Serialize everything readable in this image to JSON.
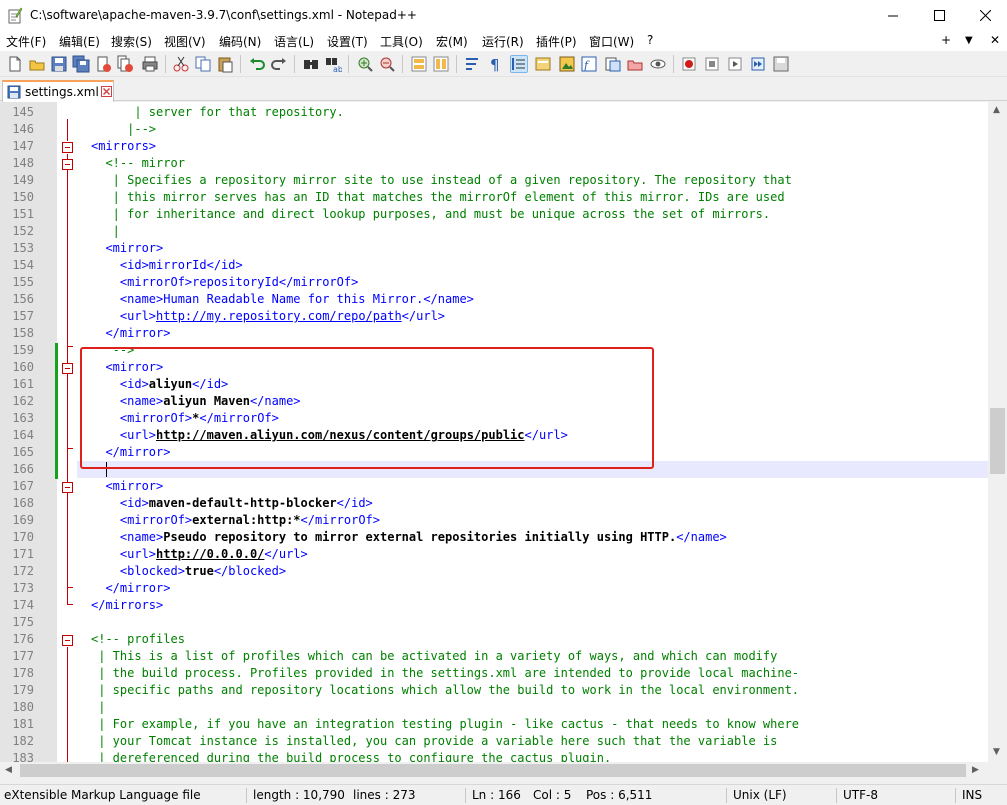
{
  "window": {
    "title": "C:\\software\\apache-maven-3.9.7\\conf\\settings.xml - Notepad++"
  },
  "menu": [
    "文件(F)",
    "编辑(E)",
    "搜索(S)",
    "视图(V)",
    "编码(N)",
    "语言(L)",
    "设置(T)",
    "工具(O)",
    "宏(M)",
    "运行(R)",
    "插件(P)",
    "窗口(W)",
    "?"
  ],
  "menu_right": [
    "+",
    "▼",
    "✕"
  ],
  "tab": {
    "label": "settings.xml"
  },
  "editor": {
    "lines": [
      {
        "n": "145",
        "segs": [
          {
            "t": "      | server for that repository.",
            "c": "cmt"
          }
        ]
      },
      {
        "n": "146",
        "segs": [
          {
            "t": "     |-->",
            "c": "cmt"
          }
        ]
      },
      {
        "n": "147",
        "segs": [
          {
            "t": "<mirrors>",
            "c": "tag"
          }
        ]
      },
      {
        "n": "148",
        "segs": [
          {
            "t": "  <!-- mirror",
            "c": "cmt"
          }
        ]
      },
      {
        "n": "149",
        "segs": [
          {
            "t": "   | Specifies a repository mirror site to use instead of a given repository. The repository that",
            "c": "cmt"
          }
        ]
      },
      {
        "n": "150",
        "segs": [
          {
            "t": "   | this mirror serves has an ID that matches the mirrorOf element of this mirror. IDs are used",
            "c": "cmt"
          }
        ]
      },
      {
        "n": "151",
        "segs": [
          {
            "t": "   | for inheritance and direct lookup purposes, and must be unique across the set of mirrors.",
            "c": "cmt"
          }
        ]
      },
      {
        "n": "152",
        "segs": [
          {
            "t": "   |",
            "c": "cmt"
          }
        ]
      },
      {
        "n": "153",
        "segs": [
          {
            "t": "  <mirror>",
            "c": "tag"
          }
        ]
      },
      {
        "n": "154",
        "segs": [
          {
            "t": "    <id>mirrorId</id>",
            "c": "tag"
          }
        ]
      },
      {
        "n": "155",
        "segs": [
          {
            "t": "    <mirrorOf>repositoryId</mirrorOf>",
            "c": "tag"
          }
        ]
      },
      {
        "n": "156",
        "segs": [
          {
            "t": "    <name>Human Readable Name for this Mirror.</name>",
            "c": "tag"
          }
        ]
      },
      {
        "n": "157",
        "segs": [
          {
            "t": "    <url>",
            "c": "tag"
          },
          {
            "t": "http://my.repository.com/repo/path",
            "c": "tag-u"
          },
          {
            "t": "</url>",
            "c": "tag"
          }
        ]
      },
      {
        "n": "158",
        "segs": [
          {
            "t": "  </mirror>",
            "c": "tag"
          }
        ]
      },
      {
        "n": "159",
        "segs": [
          {
            "t": "   -->",
            "c": "cmt"
          }
        ]
      },
      {
        "n": "160",
        "segs": [
          {
            "t": "  <mirror>",
            "c": "tag"
          }
        ]
      },
      {
        "n": "161",
        "segs": [
          {
            "t": "    <id>",
            "c": "tag"
          },
          {
            "t": "aliyun",
            "c": "txt"
          },
          {
            "t": "</id>",
            "c": "tag"
          }
        ]
      },
      {
        "n": "162",
        "segs": [
          {
            "t": "    <name>",
            "c": "tag"
          },
          {
            "t": "aliyun Maven",
            "c": "txt"
          },
          {
            "t": "</name>",
            "c": "tag"
          }
        ]
      },
      {
        "n": "163",
        "segs": [
          {
            "t": "    <mirrorOf>",
            "c": "tag"
          },
          {
            "t": "*",
            "c": "txt"
          },
          {
            "t": "</mirrorOf>",
            "c": "tag"
          }
        ]
      },
      {
        "n": "164",
        "segs": [
          {
            "t": "    <url>",
            "c": "tag"
          },
          {
            "t": "http://maven.aliyun.com/nexus/content/groups/public",
            "c": "lnk"
          },
          {
            "t": "</url>",
            "c": "tag"
          }
        ]
      },
      {
        "n": "165",
        "segs": [
          {
            "t": "  </mirror>",
            "c": "tag"
          }
        ]
      },
      {
        "n": "166",
        "segs": [
          {
            "t": "",
            "c": "txt"
          }
        ]
      },
      {
        "n": "167",
        "segs": [
          {
            "t": "  <mirror>",
            "c": "tag"
          }
        ]
      },
      {
        "n": "168",
        "segs": [
          {
            "t": "    <id>",
            "c": "tag"
          },
          {
            "t": "maven-default-http-blocker",
            "c": "txt"
          },
          {
            "t": "</id>",
            "c": "tag"
          }
        ]
      },
      {
        "n": "169",
        "segs": [
          {
            "t": "    <mirrorOf>",
            "c": "tag"
          },
          {
            "t": "external:http:*",
            "c": "txt"
          },
          {
            "t": "</mirrorOf>",
            "c": "tag"
          }
        ]
      },
      {
        "n": "170",
        "segs": [
          {
            "t": "    <name>",
            "c": "tag"
          },
          {
            "t": "Pseudo repository to mirror external repositories initially using HTTP.",
            "c": "txt"
          },
          {
            "t": "</name>",
            "c": "tag"
          }
        ]
      },
      {
        "n": "171",
        "segs": [
          {
            "t": "    <url>",
            "c": "tag"
          },
          {
            "t": "http://0.0.0.0/",
            "c": "lnk"
          },
          {
            "t": "</url>",
            "c": "tag"
          }
        ]
      },
      {
        "n": "172",
        "segs": [
          {
            "t": "    <blocked>",
            "c": "tag"
          },
          {
            "t": "true",
            "c": "txt"
          },
          {
            "t": "</blocked>",
            "c": "tag"
          }
        ]
      },
      {
        "n": "173",
        "segs": [
          {
            "t": "  </mirror>",
            "c": "tag"
          }
        ]
      },
      {
        "n": "174",
        "segs": [
          {
            "t": "</mirrors>",
            "c": "tag"
          }
        ]
      },
      {
        "n": "175",
        "segs": [
          {
            "t": "",
            "c": "txt"
          }
        ]
      },
      {
        "n": "176",
        "segs": [
          {
            "t": "<!-- profiles",
            "c": "cmt"
          }
        ]
      },
      {
        "n": "177",
        "segs": [
          {
            "t": " | This is a list of profiles which can be activated in a variety of ways, and which can modify",
            "c": "cmt"
          }
        ]
      },
      {
        "n": "178",
        "segs": [
          {
            "t": " | the build process. Profiles provided in the settings.xml are intended to provide local machine-",
            "c": "cmt"
          }
        ]
      },
      {
        "n": "179",
        "segs": [
          {
            "t": " | specific paths and repository locations which allow the build to work in the local environment.",
            "c": "cmt"
          }
        ]
      },
      {
        "n": "180",
        "segs": [
          {
            "t": " |",
            "c": "cmt"
          }
        ]
      },
      {
        "n": "181",
        "segs": [
          {
            "t": " | For example, if you have an integration testing plugin - like cactus - that needs to know where",
            "c": "cmt"
          }
        ]
      },
      {
        "n": "182",
        "segs": [
          {
            "t": " | your Tomcat instance is installed, you can provide a variable here such that the variable is",
            "c": "cmt"
          }
        ]
      },
      {
        "n": "183",
        "segs": [
          {
            "t": " | dereferenced during the build process to configure the cactus plugin.",
            "c": "cmt"
          }
        ]
      }
    ]
  },
  "status": {
    "file_type": "eXtensible Markup Language file",
    "length": "length : 10,790",
    "lines": "lines : 273",
    "ln": "Ln : 166",
    "col": "Col : 5",
    "pos": "Pos : 6,511",
    "eol": "Unix (LF)",
    "encoding": "UTF-8",
    "mode": "INS"
  },
  "colors": {
    "comment": "#008000",
    "tag": "#0000ff",
    "highlight_border": "#e0201a",
    "change_bar": "#16a11f",
    "fold_marker": "#c40000",
    "current_line": "#e8e8ff"
  },
  "toolbar_icons": [
    "new-file-icon",
    "open-file-icon",
    "save-icon",
    "save-all-icon",
    "close-icon",
    "close-all-icon",
    "print-icon",
    "cut-icon",
    "copy-icon",
    "paste-icon",
    "undo-icon",
    "redo-icon",
    "find-icon",
    "replace-icon",
    "zoom-in-icon",
    "zoom-out-icon",
    "sync-v-icon",
    "sync-h-icon",
    "word-wrap-icon",
    "show-all-chars-icon",
    "indent-guide-icon",
    "lang-udl-icon",
    "doc-map-icon",
    "function-list-icon",
    "folder-workspace-icon",
    "doc-list-icon",
    "monitor-icon",
    "record-macro-icon",
    "stop-macro-icon",
    "play-macro-icon",
    "run-multiple-icon",
    "save-macro-icon"
  ]
}
